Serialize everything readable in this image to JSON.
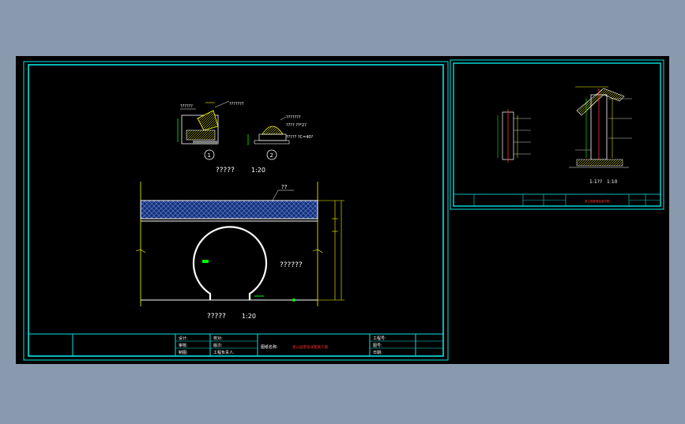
{
  "colors": {
    "background": "#8a9aae",
    "drawing_bg": "#000000",
    "frame": "#00e5e5",
    "wall": "#ffffff",
    "dim": "#ffff00",
    "hatch": "#3a6bd6",
    "accent_green": "#00ff00",
    "accent_red": "#ff3030"
  },
  "sheet1": {
    "detail1_label": "??????",
    "detail1_circle": "1",
    "detail2_label1": "???????",
    "detail2_label2": "????  ??*2?",
    "detail2_label3": "????? ?C=40?",
    "detail2_circle": "2",
    "details_caption": "?????",
    "details_scale": "1:20",
    "elevation_tag": "??",
    "opening_label": "??????",
    "elevation_caption": "?????",
    "elevation_scale": "1:20",
    "title_block": {
      "design": "设计:",
      "check": "审核:",
      "draw": "制图:",
      "review": "校对:",
      "project_no": "工程号:",
      "project_name": "图纸名称:",
      "project_name_value": "某公园景墙详图施工图",
      "drawing_no": "图号:",
      "date": "日期:",
      "rev": "版次:",
      "company": "工程负责人:"
    }
  },
  "sheet2": {
    "section_caption": "1-1??",
    "section_scale": "1:10",
    "title_block_text": "某公园景墙剖面详图"
  }
}
